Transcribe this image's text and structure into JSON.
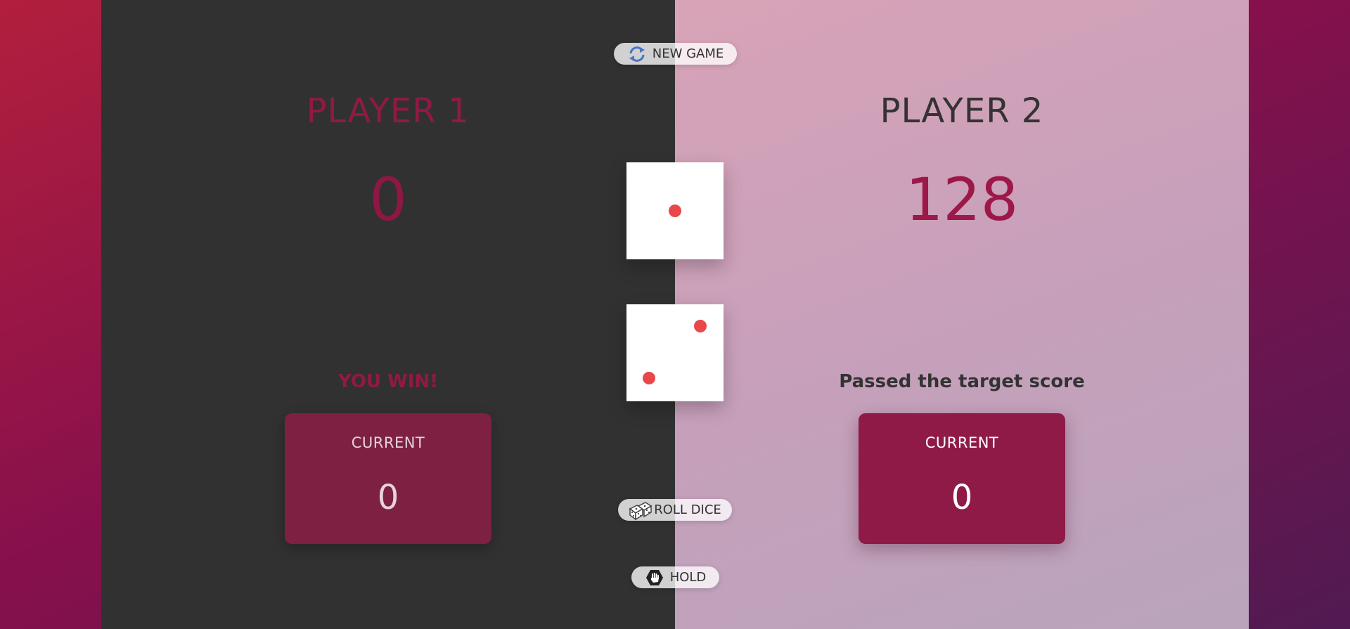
{
  "controls": {
    "new_game_label": "NEW GAME",
    "new_game_icon": "refresh-icon",
    "roll_dice_label": "ROLL DICE",
    "roll_dice_icon": "dice-icon",
    "hold_label": "HOLD",
    "hold_icon": "hand-icon"
  },
  "players": [
    {
      "name": "PLAYER 1",
      "score": "0",
      "message": "YOU WIN!",
      "current_label": "CURRENT",
      "current_score": "0"
    },
    {
      "name": "PLAYER 2",
      "score": "128",
      "message": "Passed the target score",
      "current_label": "CURRENT",
      "current_score": "0"
    }
  ],
  "dice": [
    {
      "value": 1
    },
    {
      "value": 2
    }
  ],
  "colors": {
    "accent": "#8f1a47",
    "pip": "#e8484a",
    "active_panel": "#313131"
  }
}
